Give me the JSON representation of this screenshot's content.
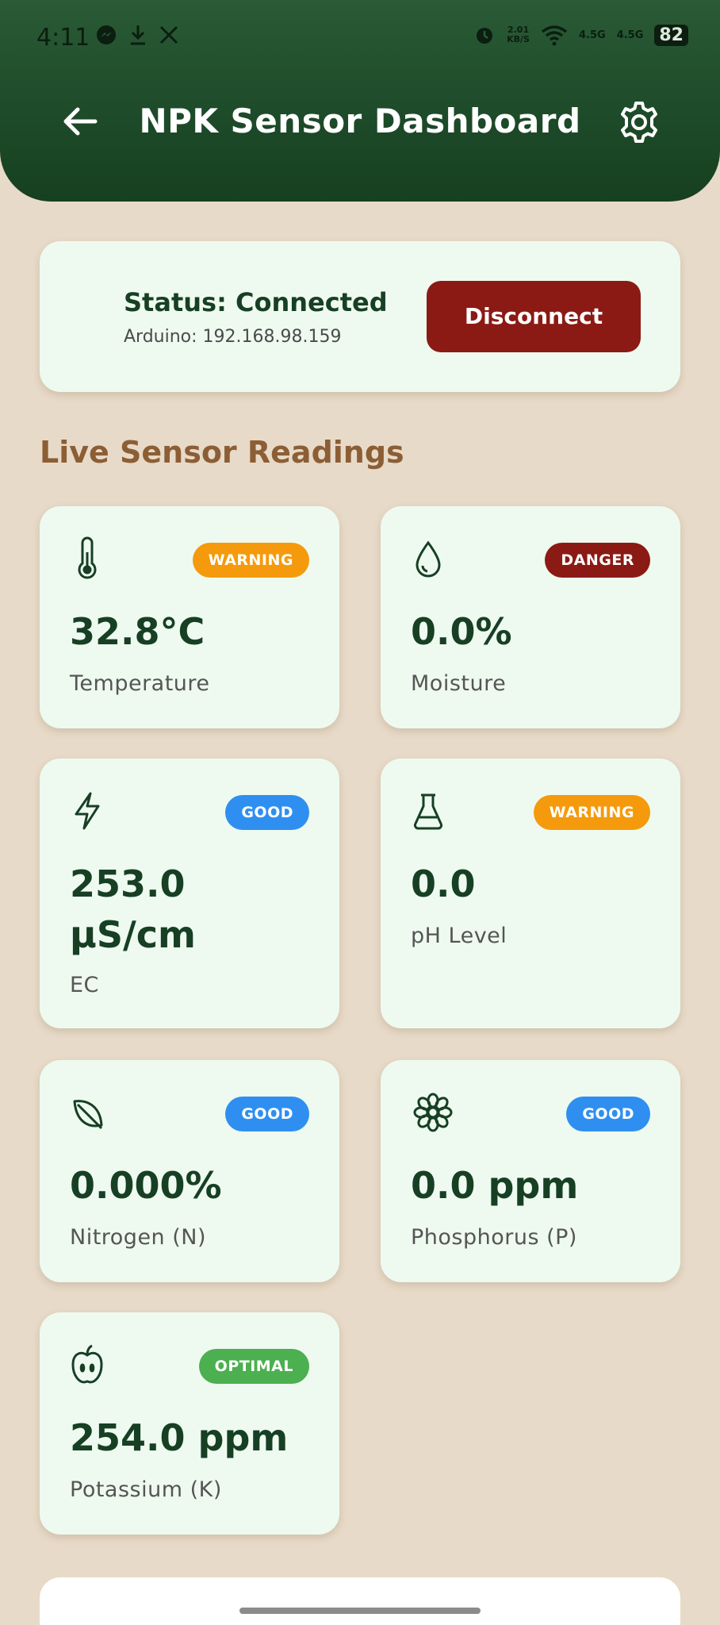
{
  "status_bar": {
    "time": "4:11",
    "net_speed_top": "2.01",
    "net_speed_bottom": "KB/S",
    "signal1": "4.5G",
    "signal2": "4.5G",
    "battery": "82"
  },
  "header": {
    "title": "NPK Sensor Dashboard",
    "back_icon": "arrow-left-icon",
    "settings_icon": "gear-icon"
  },
  "connection": {
    "status": "Status: Connected",
    "device": "Arduino: 192.168.98.159",
    "disconnect_label": "Disconnect",
    "dot_color": "#4caf50"
  },
  "section_title": "Live Sensor Readings",
  "sensors": [
    {
      "label": "Temperature",
      "value": "32.8°C",
      "status": "WARNING",
      "status_color": "#f59a0c",
      "icon": "thermometer-icon"
    },
    {
      "label": "Moisture",
      "value": "0.0%",
      "status": "DANGER",
      "status_color": "#8b1a14",
      "icon": "water-drop-icon"
    },
    {
      "label": "EC",
      "value": "253.0 µS/cm",
      "status": "GOOD",
      "status_color": "#2f8ff0",
      "icon": "lightning-icon"
    },
    {
      "label": "pH Level",
      "value": "0.0",
      "status": "WARNING",
      "status_color": "#f59a0c",
      "icon": "flask-icon"
    },
    {
      "label": "Nitrogen (N)",
      "value": "0.000%",
      "status": "GOOD",
      "status_color": "#2f8ff0",
      "icon": "leaf-icon"
    },
    {
      "label": "Phosphorus (P)",
      "value": "0.0 ppm",
      "status": "GOOD",
      "status_color": "#2f8ff0",
      "icon": "flower-icon"
    },
    {
      "label": "Potassium (K)",
      "value": "254.0 ppm",
      "status": "OPTIMAL",
      "status_color": "#4caf50",
      "icon": "apple-icon"
    }
  ],
  "colors": {
    "header": "#1d4a29",
    "background": "#e8dac8",
    "card": "#eefaf0",
    "value_text": "#173f24",
    "section_title": "#8c5e35"
  }
}
